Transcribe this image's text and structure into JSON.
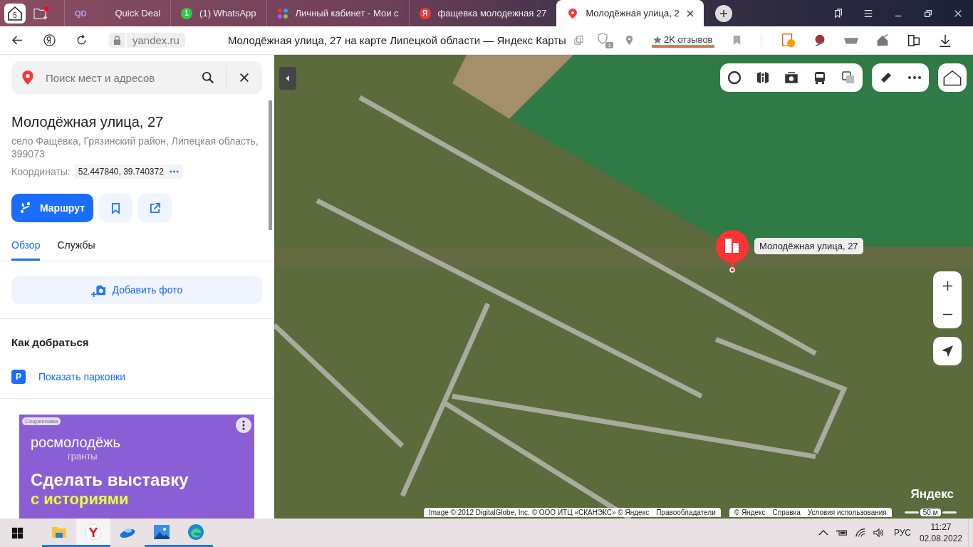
{
  "browser": {
    "side_count": "5",
    "tabs": [
      {
        "kind": "qd",
        "icon_text": "QD",
        "title": "Quick Deal",
        "selected": false
      },
      {
        "kind": "whatsapp",
        "icon_text": "1",
        "title": "(1) WhatsApp",
        "selected": false
      },
      {
        "kind": "dots",
        "title": "Личный кабинет - Мои с",
        "selected": false
      },
      {
        "kind": "yandex",
        "icon_text": "Я",
        "title": "фащевка молодежная 27",
        "selected": false
      },
      {
        "kind": "pin",
        "title": "Молодёжная улица, 2",
        "selected": true
      }
    ],
    "url": "yandex.ru",
    "page_title": "Молодёжная улица, 27 на карте Липецкой области — Яндекс Карты",
    "shield_badge": "1",
    "reviews": "2K отзывов"
  },
  "panel": {
    "search": {
      "placeholder": "Поиск мест и адресов"
    },
    "title": "Молодёжная улица, 27",
    "address": "село Фащёвка, Грязинский район, Липецкая область, 399073",
    "coords_label": "Координаты:",
    "coords": "52.447840, 39.740372",
    "route_button": "Маршрут",
    "tabs": [
      {
        "label": "Обзор",
        "selected": true
      },
      {
        "label": "Службы",
        "selected": false
      }
    ],
    "add_photo": "Добавить фото",
    "section": "Как добраться",
    "parking_link": "Показать парковки",
    "parking_icon": "P",
    "ad": {
      "tag": "Соцреклама",
      "brand": "росмолодёжь",
      "brand_sub": "гранты",
      "headline": "Сделать выставку",
      "highlight": "с историями"
    }
  },
  "map": {
    "marker_label": "Молодёжная улица, 27",
    "logo": "Яндекс",
    "scale": "50 м",
    "attribution_left": [
      "Image © 2012 DigitalGlobe, Inc. © ООО ИТЦ «СКАНЭКС» © Яндекс",
      "Правообладатели"
    ],
    "attribution_right": [
      "© Яндекс",
      "Справка",
      "Условия использования"
    ]
  },
  "taskbar": {
    "apps": [
      {
        "kind": "explorer",
        "running": true,
        "selected": false
      },
      {
        "kind": "yandex",
        "running": true,
        "selected": true
      },
      {
        "kind": "saucer",
        "running": false,
        "selected": false
      },
      {
        "kind": "photos",
        "running": true,
        "selected": false
      },
      {
        "kind": "edge",
        "running": true,
        "selected": false
      }
    ],
    "language": "РУС",
    "time": "11:27",
    "date": "02.08.2022"
  }
}
